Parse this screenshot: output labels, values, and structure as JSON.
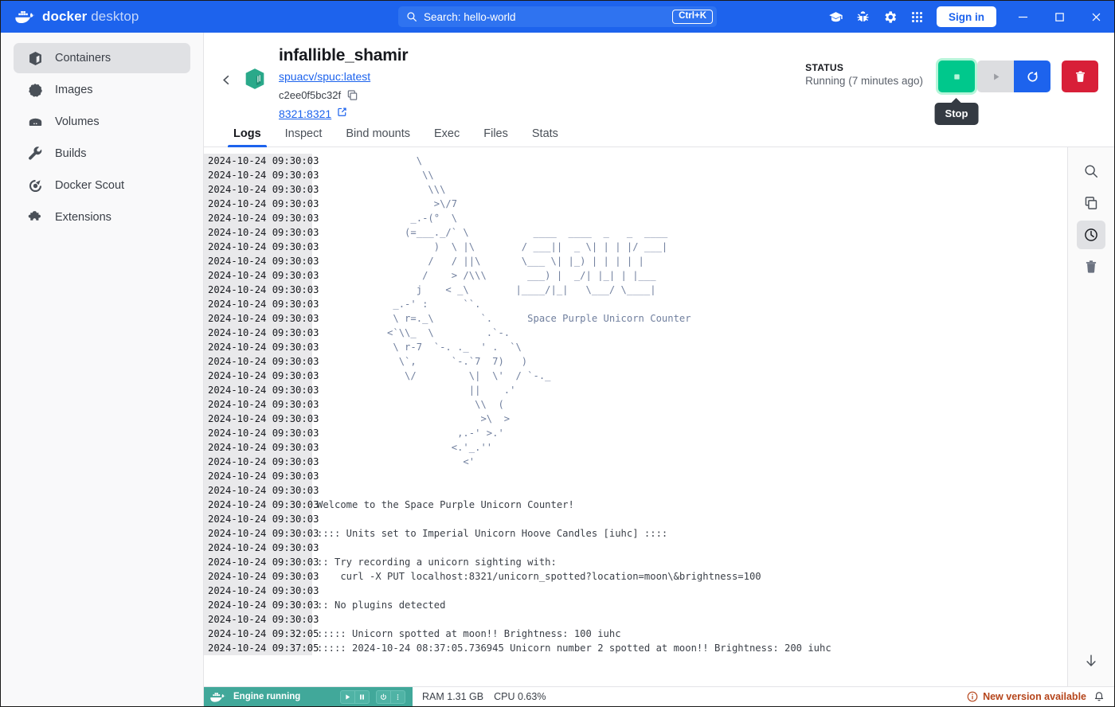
{
  "titlebar": {
    "brand_bold": "docker",
    "brand_light": "desktop",
    "search_text": "Search: hello-world",
    "search_placeholder": "Search",
    "shortcut": "Ctrl+K",
    "signin_label": "Sign in",
    "icons": [
      "learning-center-icon",
      "bug-icon",
      "gear-icon",
      "apps-grid-icon"
    ],
    "accent_color": "#1d63ed"
  },
  "sidebar": {
    "items": [
      {
        "label": "Containers",
        "icon": "containers-icon",
        "active": true
      },
      {
        "label": "Images",
        "icon": "images-icon",
        "active": false
      },
      {
        "label": "Volumes",
        "icon": "volumes-icon",
        "active": false
      },
      {
        "label": "Builds",
        "icon": "builds-wrench-icon",
        "active": false
      },
      {
        "label": "Docker Scout",
        "icon": "docker-scout-icon",
        "active": false
      },
      {
        "label": "Extensions",
        "icon": "extensions-puzzle-icon",
        "active": false
      }
    ]
  },
  "container": {
    "name": "infallible_shamir",
    "image": "spuacv/spuc:latest",
    "id": "c2ee0f5bc32f",
    "ports": "8321:8321",
    "status_label": "STATUS",
    "status_value": "Running (7 minutes ago)",
    "tooltip": "Stop",
    "actions": {
      "stop": "Stop",
      "start": "Start",
      "restart": "Restart",
      "delete": "Delete"
    },
    "colors": {
      "stop": "#00c88c",
      "stop_ring": "#b6f5d9",
      "start": "#dcdde0",
      "restart": "#1d63ed",
      "delete": "#d81f38"
    }
  },
  "tabs": [
    {
      "label": "Logs",
      "active": true
    },
    {
      "label": "Inspect",
      "active": false
    },
    {
      "label": "Bind mounts",
      "active": false
    },
    {
      "label": "Exec",
      "active": false
    },
    {
      "label": "Files",
      "active": false
    },
    {
      "label": "Stats",
      "active": false
    }
  ],
  "log_tools": [
    {
      "name": "search-icon",
      "active": false
    },
    {
      "name": "copy-icon",
      "active": false
    },
    {
      "name": "clock-icon",
      "active": true
    },
    {
      "name": "trash-icon",
      "active": false
    }
  ],
  "scroll_to_bottom": "scroll-down-icon",
  "logs": [
    {
      "ts": "2024-10-24 09:30:03",
      "msg": "                 \\",
      "art": true
    },
    {
      "ts": "2024-10-24 09:30:03",
      "msg": "                  \\\\",
      "art": true
    },
    {
      "ts": "2024-10-24 09:30:03",
      "msg": "                   \\\\\\",
      "art": true
    },
    {
      "ts": "2024-10-24 09:30:03",
      "msg": "                    >\\/7",
      "art": true
    },
    {
      "ts": "2024-10-24 09:30:03",
      "msg": "                _.-(°  \\",
      "art": true
    },
    {
      "ts": "2024-10-24 09:30:03",
      "msg": "               (=___._/` \\           ____  ____  _   _  ____",
      "art": true
    },
    {
      "ts": "2024-10-24 09:30:03",
      "msg": "                    )  \\ |\\        / ___||  _ \\| | | |/ ___|",
      "art": true
    },
    {
      "ts": "2024-10-24 09:30:03",
      "msg": "                   /   / ||\\       \\___ \\| |_) | | | | |",
      "art": true
    },
    {
      "ts": "2024-10-24 09:30:03",
      "msg": "                  /    > /\\\\\\       ___) |  _/| |_| | |___",
      "art": true
    },
    {
      "ts": "2024-10-24 09:30:03",
      "msg": "                 j    < _\\        |____/|_|   \\___/ \\____|",
      "art": true
    },
    {
      "ts": "2024-10-24 09:30:03",
      "msg": "             _.-' :      ``.",
      "art": true
    },
    {
      "ts": "2024-10-24 09:30:03",
      "msg": "             \\ r=._\\        `.      Space Purple Unicorn Counter",
      "art": true
    },
    {
      "ts": "2024-10-24 09:30:03",
      "msg": "            <`\\\\_  \\         .`-.",
      "art": true
    },
    {
      "ts": "2024-10-24 09:30:03",
      "msg": "             \\ r-7  `-. ._  ' .  `\\",
      "art": true
    },
    {
      "ts": "2024-10-24 09:30:03",
      "msg": "              \\`,      `-.`7  7)   )",
      "art": true
    },
    {
      "ts": "2024-10-24 09:30:03",
      "msg": "               \\/         \\|  \\'  / `-._",
      "art": true
    },
    {
      "ts": "2024-10-24 09:30:03",
      "msg": "                          ||    .'",
      "art": true
    },
    {
      "ts": "2024-10-24 09:30:03",
      "msg": "                           \\\\  (",
      "art": true
    },
    {
      "ts": "2024-10-24 09:30:03",
      "msg": "                            >\\  >",
      "art": true
    },
    {
      "ts": "2024-10-24 09:30:03",
      "msg": "                        ,.-' >.'",
      "art": true
    },
    {
      "ts": "2024-10-24 09:30:03",
      "msg": "                       <.'_.''",
      "art": true
    },
    {
      "ts": "2024-10-24 09:30:03",
      "msg": "                         <'",
      "art": true
    },
    {
      "ts": "2024-10-24 09:30:03",
      "msg": "",
      "art": false
    },
    {
      "ts": "2024-10-24 09:30:03",
      "msg": "",
      "art": false
    },
    {
      "ts": "2024-10-24 09:30:03",
      "msg": "Welcome to the Space Purple Unicorn Counter!",
      "art": false
    },
    {
      "ts": "2024-10-24 09:30:03",
      "msg": "",
      "art": false
    },
    {
      "ts": "2024-10-24 09:30:03",
      "msg": ":::: Units set to Imperial Unicorn Hoove Candles [iuhc] ::::",
      "art": false
    },
    {
      "ts": "2024-10-24 09:30:03",
      "msg": "",
      "art": false
    },
    {
      "ts": "2024-10-24 09:30:03",
      "msg": ":: Try recording a unicorn sighting with:",
      "art": false
    },
    {
      "ts": "2024-10-24 09:30:03",
      "msg": "    curl -X PUT localhost:8321/unicorn_spotted?location=moon\\&brightness=100",
      "art": false
    },
    {
      "ts": "2024-10-24 09:30:03",
      "msg": "",
      "art": false
    },
    {
      "ts": "2024-10-24 09:30:03",
      "msg": ":: No plugins detected",
      "art": false
    },
    {
      "ts": "2024-10-24 09:30:03",
      "msg": "",
      "art": false
    },
    {
      "ts": "2024-10-24 09:32:05",
      "msg": "::::: Unicorn spotted at moon!! Brightness: 100 iuhc",
      "art": false
    },
    {
      "ts": "2024-10-24 09:37:05",
      "msg": "::::: 2024-10-24 08:37:05.736945 Unicorn number 2 spotted at moon!! Brightness: 200 iuhc",
      "art": false
    }
  ],
  "statusbar": {
    "engine_text": "Engine running",
    "engine_color": "#41a89a",
    "ram": "RAM 1.31 GB",
    "cpu": "CPU 0.63%",
    "new_version": "New version available",
    "new_version_color": "#b5451b",
    "engine_controls": [
      "play-icon",
      "pause-icon",
      "power-icon",
      "more-vertical-icon"
    ]
  }
}
